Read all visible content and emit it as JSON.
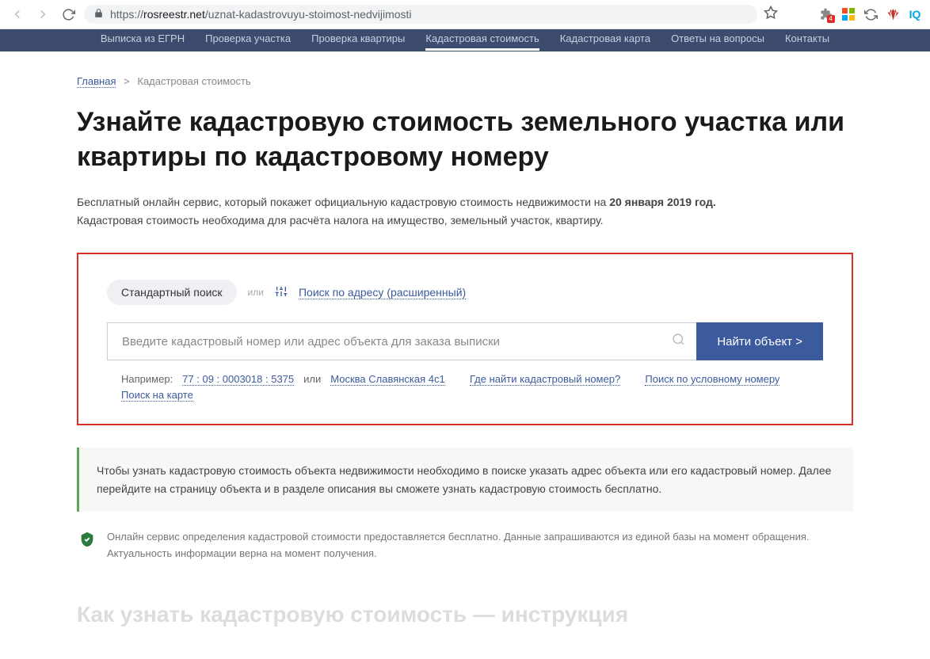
{
  "browser": {
    "url_proto": "https://",
    "url_domain": "rosreestr.net",
    "url_path": "/uznat-kadastrovuyu-stoimost-nedvijimosti",
    "ext_badge": "4"
  },
  "nav": {
    "items": [
      "Выписка из ЕГРН",
      "Проверка участка",
      "Проверка квартиры",
      "Кадастровая стоимость",
      "Кадастровая карта",
      "Ответы на вопросы",
      "Контакты"
    ]
  },
  "breadcrumb": {
    "home": "Главная",
    "sep": ">",
    "current": "Кадастровая стоимость"
  },
  "heading": "Узнайте кадастровую стоимость земельного участка или квартиры по кадастровому номеру",
  "intro": {
    "line1_a": "Бесплатный онлайн сервис, который покажет официальную кадастровую стоимость недвижимости на ",
    "line1_b": "20 января 2019 год.",
    "line2": "Кадастровая стоимость необходима для расчёта налога на имущество, земельный участок, квартиру."
  },
  "search": {
    "tab_standard": "Стандартный поиск",
    "tab_sep": "или",
    "tab_advanced": "Поиск по адресу (расширенный)",
    "placeholder": "Введите кадастровый номер или адрес объекта для заказа выписки",
    "button": "Найти объект >",
    "hints": {
      "prefix": "Например:",
      "ex1": "77 : 09 : 0003018 : 5375",
      "or": "или",
      "ex2": "Москва Славянская 4c1",
      "where": "Где найти кадастровый номер?",
      "by_conv": "Поиск по условному номеру",
      "on_map": "Поиск на карте"
    }
  },
  "info1": "Чтобы узнать кадастровую стоимость объекта недвижимости необходимо в поиске указать адрес объекта или его кадастровый номер. Далее перейдите на страницу объекта и в разделе описания вы сможете узнать кадастровую стоимость бесплатно.",
  "info2": "Онлайн сервис определения кадастровой стоимости предоставляется бесплатно. Данные запрашиваются из единой базы на момент обращения. Актуальность информации верна на момент получения.",
  "bottom_heading": "Как узнать кадастровую стоимость — инструкция"
}
